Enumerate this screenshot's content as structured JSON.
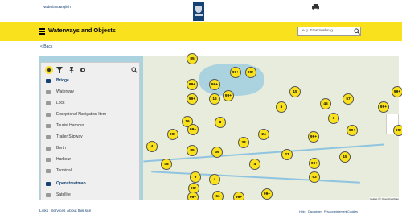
{
  "topbar": {
    "lang_nl": "Nederlands",
    "lang_en": "English"
  },
  "header": {
    "title": "Waterways and Objects",
    "search_placeholder": "e.g. Erasmusbrug"
  },
  "nav": {
    "back": "< Back"
  },
  "panel": {
    "items": [
      {
        "label": "Bridge",
        "selected": true
      },
      {
        "label": "Waterway"
      },
      {
        "label": "Lock"
      },
      {
        "label": "Exceptional Navigation Item"
      },
      {
        "label": "Tourist Harbour"
      },
      {
        "label": "Trailer Slipway"
      },
      {
        "label": "Berth"
      },
      {
        "label": "Harbour"
      },
      {
        "label": "Terminal"
      },
      {
        "label": "Openstreetmap",
        "selected": true
      },
      {
        "label": "Satellite"
      }
    ]
  },
  "markers": [
    "85",
    "99+",
    "99+",
    "99+",
    "99+",
    "15",
    "99+",
    "16",
    "99+",
    "5",
    "57",
    "99+",
    "99+",
    "6",
    "45",
    "16",
    "99+",
    "8",
    "99+",
    "24",
    "99+",
    "99+",
    "99+",
    "33",
    "4",
    "85",
    "39",
    "21",
    "4",
    "15",
    "48",
    "9",
    "99+",
    "4",
    "99+",
    "93",
    "61",
    "99+",
    "99+",
    "99+",
    "65"
  ],
  "map": {
    "attribution": "Leaflet | © OpenStreetMap"
  },
  "footer": {
    "links": [
      "Links",
      "Services",
      "About this site"
    ],
    "right_links": [
      "Help",
      "Disclaimer",
      "Privacy statement",
      "Cookies"
    ]
  },
  "colors": {
    "accent": "#f9e11e",
    "brand": "#154273"
  }
}
